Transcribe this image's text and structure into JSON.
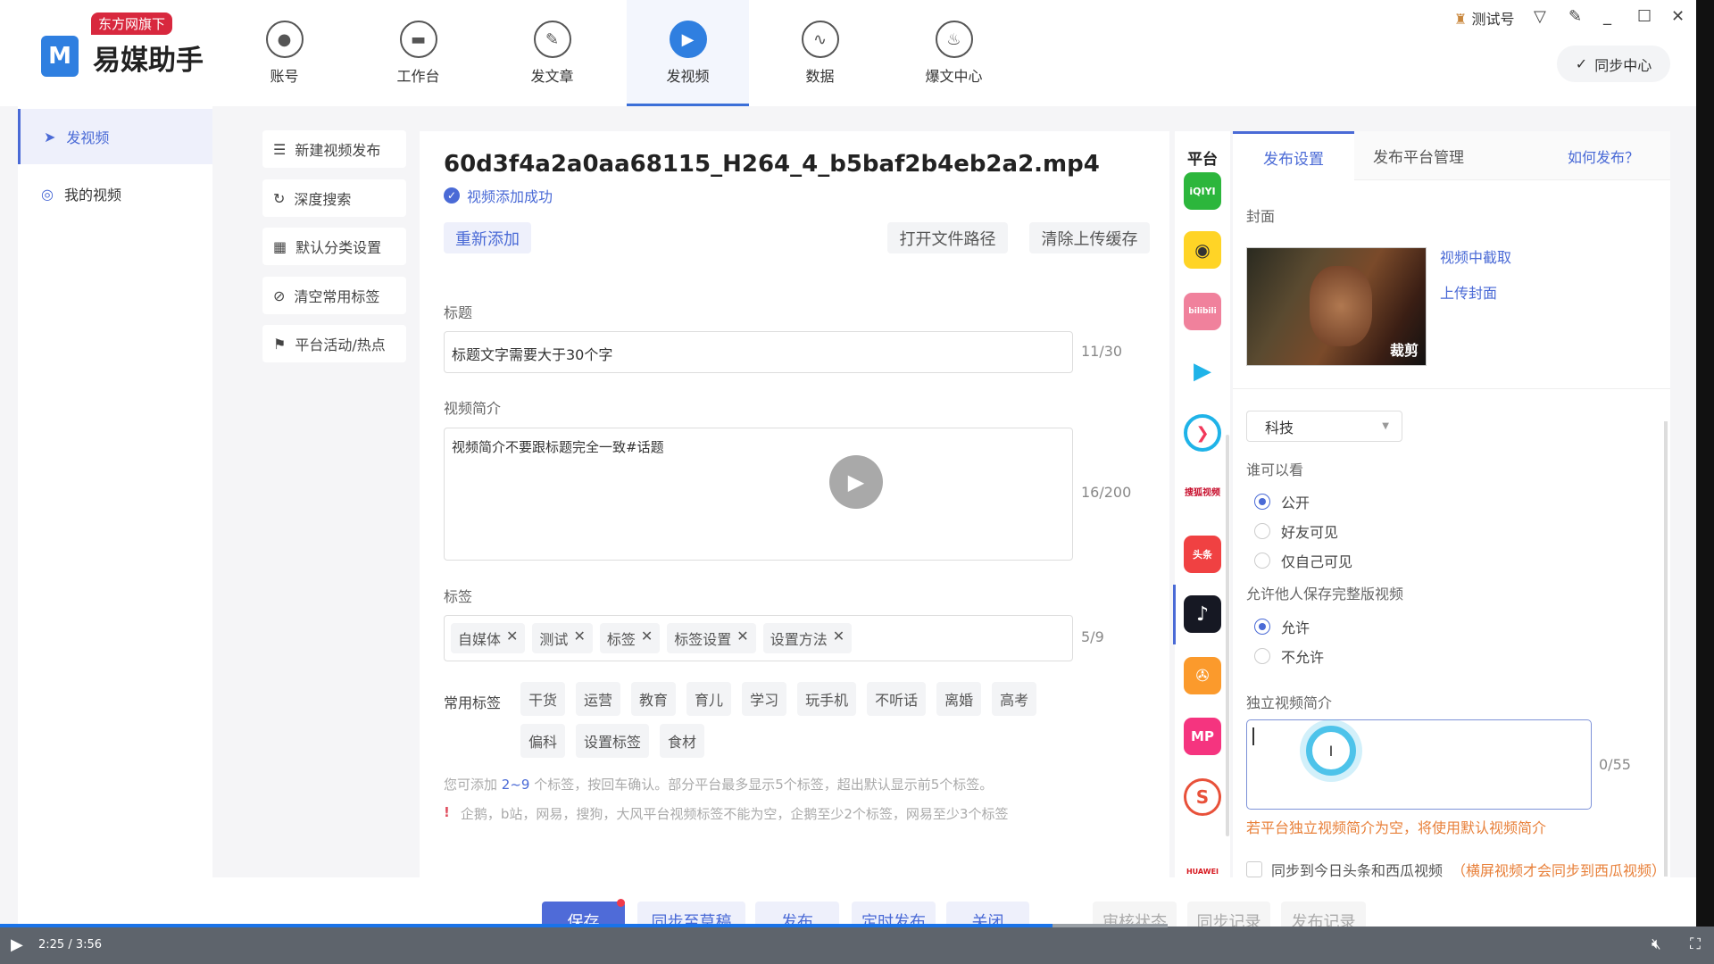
{
  "app": {
    "badge": "东方网旗下",
    "logo_letter": "M",
    "name": "易媒助手"
  },
  "nav": [
    {
      "label": "账号",
      "icon": "user-icon"
    },
    {
      "label": "工作台",
      "icon": "monitor-icon"
    },
    {
      "label": "发文章",
      "icon": "feather-icon"
    },
    {
      "label": "发视频",
      "icon": "play-icon",
      "active": true
    },
    {
      "label": "数据",
      "icon": "chart-icon"
    },
    {
      "label": "爆文中心",
      "icon": "fire-icon"
    }
  ],
  "topright": {
    "account": "测试号",
    "sync_center": "同步中心"
  },
  "sidebar": [
    {
      "label": "发视频",
      "active": true
    },
    {
      "label": "我的视频"
    }
  ],
  "submenu": [
    "新建视频发布",
    "深度搜索",
    "默认分类设置",
    "清空常用标签",
    "平台活动/热点"
  ],
  "main": {
    "filename": "60d3f4a2a0aa68115_H264_4_b5baf2b4eb2a2.mp4",
    "status": "视频添加成功",
    "readd": "重新添加",
    "open_path": "打开文件路径",
    "clear_cache": "清除上传缓存",
    "title_label": "标题",
    "title_value": "标题文字需要大于30个字",
    "title_count": "11/30",
    "desc_label": "视频简介",
    "desc_value": "视频简介不要跟标题完全一致#话题",
    "desc_count": "16/200",
    "tags_label": "标签",
    "tags": [
      "自媒体",
      "测试",
      "标签",
      "标签设置",
      "设置方法"
    ],
    "tags_count": "5/9",
    "common_label": "常用标签",
    "common_tags": [
      "干货",
      "运营",
      "教育",
      "育儿",
      "学习",
      "玩手机",
      "不听话",
      "离婚",
      "高考",
      "偏科",
      "设置标签",
      "食材"
    ],
    "hint_pre": "您可添加 ",
    "hint_range": "2~9",
    "hint_post": " 个标签，按回车确认。部分平台最多显示5个标签，超出默认显示前5个标签。",
    "warning": "企鹅，b站，网易，搜狗，大风平台视频标签不能为空，企鹅至少2个标签，网易至少3个标签"
  },
  "platforms": {
    "header": "平台",
    "items": [
      "iqiyi",
      "camera-app",
      "bilibili",
      "tencent-video",
      "youku",
      "sohu-video",
      "toutiao",
      "douyin",
      "kuaishou",
      "meipai",
      "sogou",
      "huawei"
    ],
    "iqiyi_text": "iQIYI",
    "bili_text": "bilibili",
    "sohu_text": "搜狐视频",
    "toutiao_text": "头条",
    "meipai_text": "MP",
    "huawei_text": "HUAWEI"
  },
  "right": {
    "tabs": [
      "发布设置",
      "发布平台管理"
    ],
    "help": "如何发布？",
    "cover_label": "封面",
    "crop": "裁剪",
    "capture": "视频中截取",
    "upload": "上传封面",
    "category": "科技",
    "who_label": "谁可以看",
    "who_options": [
      "公开",
      "好友可见",
      "仅自己可见"
    ],
    "who_selected": 0,
    "save_label": "允许他人保存完整版视频",
    "save_options": [
      "允许",
      "不允许"
    ],
    "save_selected": 0,
    "indep_label": "独立视频简介",
    "indep_count": "0/55",
    "indep_hint": "若平台独立视频简介为空，将使用默认视频简介",
    "sync_label": "同步到今日头条和西瓜视频",
    "sync_note": "（横屏视频才会同步到西瓜视频）"
  },
  "bottom": {
    "buttons": [
      "保存",
      "同步至草稿",
      "发布",
      "定时发布",
      "关闭"
    ],
    "records": [
      "审核状态",
      "同步记录",
      "发布记录"
    ]
  },
  "video": {
    "time": "2:25 / 3:56",
    "progress": 0.614,
    "buffered": 0.681
  },
  "colors": {
    "accent": "#4a6ad6",
    "warning": "#e8803a"
  }
}
